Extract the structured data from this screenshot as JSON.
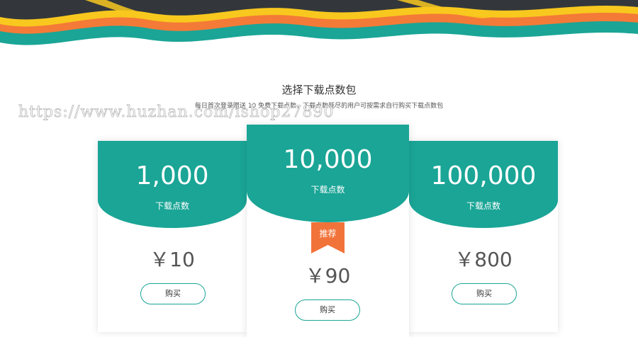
{
  "header": {
    "title": "选择下载点数包",
    "subtitle": "每日首次登录赠送 10 免费下载点数，下载点数耗尽的用户可按需求自行购买下载点数包"
  },
  "watermark": "https://www.huzhan.com/ishop27890",
  "packages": [
    {
      "points": "1,000",
      "points_label": "下载点数",
      "price": "￥10",
      "buy_label": "购买"
    },
    {
      "points": "10,000",
      "points_label": "下载点数",
      "price": "￥90",
      "buy_label": "购买",
      "badge": "推荐"
    },
    {
      "points": "100,000",
      "points_label": "下载点数",
      "price": "￥800",
      "buy_label": "购买"
    }
  ],
  "colors": {
    "accent": "#1aa596",
    "badge": "#f2733a",
    "wave_orange": "#f47a37",
    "wave_yellow": "#f8c81f",
    "banner_dark": "#33373c"
  }
}
